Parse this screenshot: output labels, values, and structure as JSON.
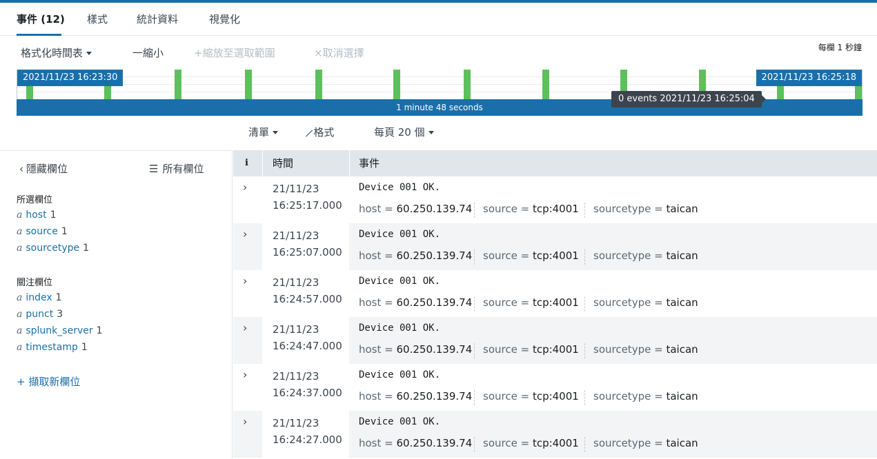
{
  "tabs": [
    {
      "label": "事件 (12)"
    },
    {
      "label": "樣式"
    },
    {
      "label": "統計資料"
    },
    {
      "label": "視覺化"
    }
  ],
  "timeline_toolbar": {
    "format_label": "格式化時間表",
    "zoom_out_label": "一縮小",
    "zoom_selection_label": "+縮放至選取範圍",
    "deselect_label": "×取消選擇",
    "bucket_label": "每欄 1 秒鐘"
  },
  "timeline": {
    "start": "2021/11/23 16:23:30",
    "end": "2021/11/23 16:25:18",
    "duration": "1 minute 48 seconds",
    "tooltip": "0 events 2021/11/23 16:25:04",
    "bar_color": "#5cc05c",
    "axis_color": "#1a6faa"
  },
  "results_toolbar": {
    "list_label": "清單",
    "format_label": "格式",
    "per_page_label": "每頁 20 個"
  },
  "sidebar": {
    "hide_fields_label": "隱藏欄位",
    "all_fields_label": "所有欄位",
    "selected_heading": "所選欄位",
    "selected_fields": [
      {
        "type": "a",
        "name": "host",
        "count": "1"
      },
      {
        "type": "a",
        "name": "source",
        "count": "1"
      },
      {
        "type": "a",
        "name": "sourcetype",
        "count": "1"
      }
    ],
    "interesting_heading": "關注欄位",
    "interesting_fields": [
      {
        "type": "a",
        "name": "index",
        "count": "1"
      },
      {
        "type": "a",
        "name": "punct",
        "count": "3"
      },
      {
        "type": "a",
        "name": "splunk_server",
        "count": "1"
      },
      {
        "type": "a",
        "name": "timestamp",
        "count": "1"
      }
    ],
    "extract_label": "+ 擷取新欄位"
  },
  "table": {
    "headers": {
      "info": "i",
      "time": "時間",
      "event": "事件"
    },
    "rows": [
      {
        "date": "21/11/23",
        "time": "16:25:17.000",
        "raw": "Device 001 OK.",
        "host_key": "host =",
        "host": "60.250.139.74",
        "source_key": "source =",
        "source": "tcp:4001",
        "sourcetype_key": "sourcetype =",
        "sourcetype": "taican"
      },
      {
        "date": "21/11/23",
        "time": "16:25:07.000",
        "raw": "Device 001 OK.",
        "host_key": "host =",
        "host": "60.250.139.74",
        "source_key": "source =",
        "source": "tcp:4001",
        "sourcetype_key": "sourcetype =",
        "sourcetype": "taican"
      },
      {
        "date": "21/11/23",
        "time": "16:24:57.000",
        "raw": "Device 001 OK.",
        "host_key": "host =",
        "host": "60.250.139.74",
        "source_key": "source =",
        "source": "tcp:4001",
        "sourcetype_key": "sourcetype =",
        "sourcetype": "taican"
      },
      {
        "date": "21/11/23",
        "time": "16:24:47.000",
        "raw": "Device 001 OK.",
        "host_key": "host =",
        "host": "60.250.139.74",
        "source_key": "source =",
        "source": "tcp:4001",
        "sourcetype_key": "sourcetype =",
        "sourcetype": "taican"
      },
      {
        "date": "21/11/23",
        "time": "16:24:37.000",
        "raw": "Device 001 OK.",
        "host_key": "host =",
        "host": "60.250.139.74",
        "source_key": "source =",
        "source": "tcp:4001",
        "sourcetype_key": "sourcetype =",
        "sourcetype": "taican"
      },
      {
        "date": "21/11/23",
        "time": "16:24:27.000",
        "raw": "Device 001 OK.",
        "host_key": "host =",
        "host": "60.250.139.74",
        "source_key": "source =",
        "source": "tcp:4001",
        "sourcetype_key": "sourcetype =",
        "sourcetype": "taican"
      }
    ]
  }
}
